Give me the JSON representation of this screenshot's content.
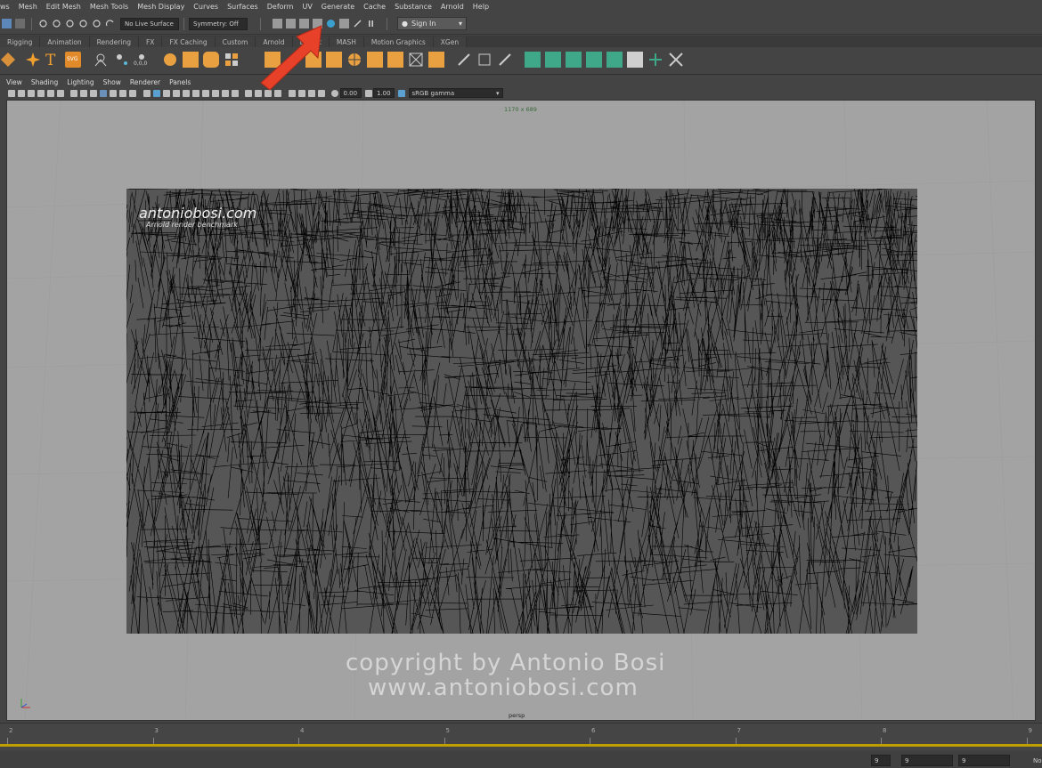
{
  "menus": [
    "ws",
    "Mesh",
    "Edit Mesh",
    "Mesh Tools",
    "Mesh Display",
    "Curves",
    "Surfaces",
    "Deform",
    "UV",
    "Generate",
    "Cache",
    "Substance",
    "Arnold",
    "Help"
  ],
  "status": {
    "live_surface": "No Live Surface",
    "symmetry": "Symmetry: Off",
    "sign_in": "Sign In"
  },
  "shelf_tabs": [
    "Rigging",
    "Animation",
    "Rendering",
    "FX",
    "FX Caching",
    "Custom",
    "Arnold",
    "Bifrost",
    "MASH",
    "Motion Graphics",
    "XGen"
  ],
  "shelf_text_icons": {
    "text_tool": "T",
    "svg_tool": "SVG",
    "uv_label": "0,0,0"
  },
  "panel_menus": [
    "View",
    "Shading",
    "Lighting",
    "Show",
    "Renderer",
    "Panels"
  ],
  "panel_toolbar": {
    "exposure": "0.00",
    "gamma": "1.00",
    "color_space": "sRGB gamma"
  },
  "viewport": {
    "resolution_gate": "1170 x 689",
    "camera": "persp",
    "watermark_site": "antoniobosi.com",
    "watermark_sub": "Arnold render benchmark",
    "copyright_line1": "copyright by Antonio Bosi",
    "copyright_line2": "www.antoniobosi.com"
  },
  "timeline": {
    "ticks": [
      "2",
      "3",
      "4",
      "5",
      "6",
      "7",
      "8",
      "9"
    ],
    "current_frame": "9",
    "range_start": "9",
    "range_end": "9",
    "right_label": "No"
  },
  "colors": {
    "accent_arrow": "#e8412a",
    "playhead": "#c0a000"
  }
}
